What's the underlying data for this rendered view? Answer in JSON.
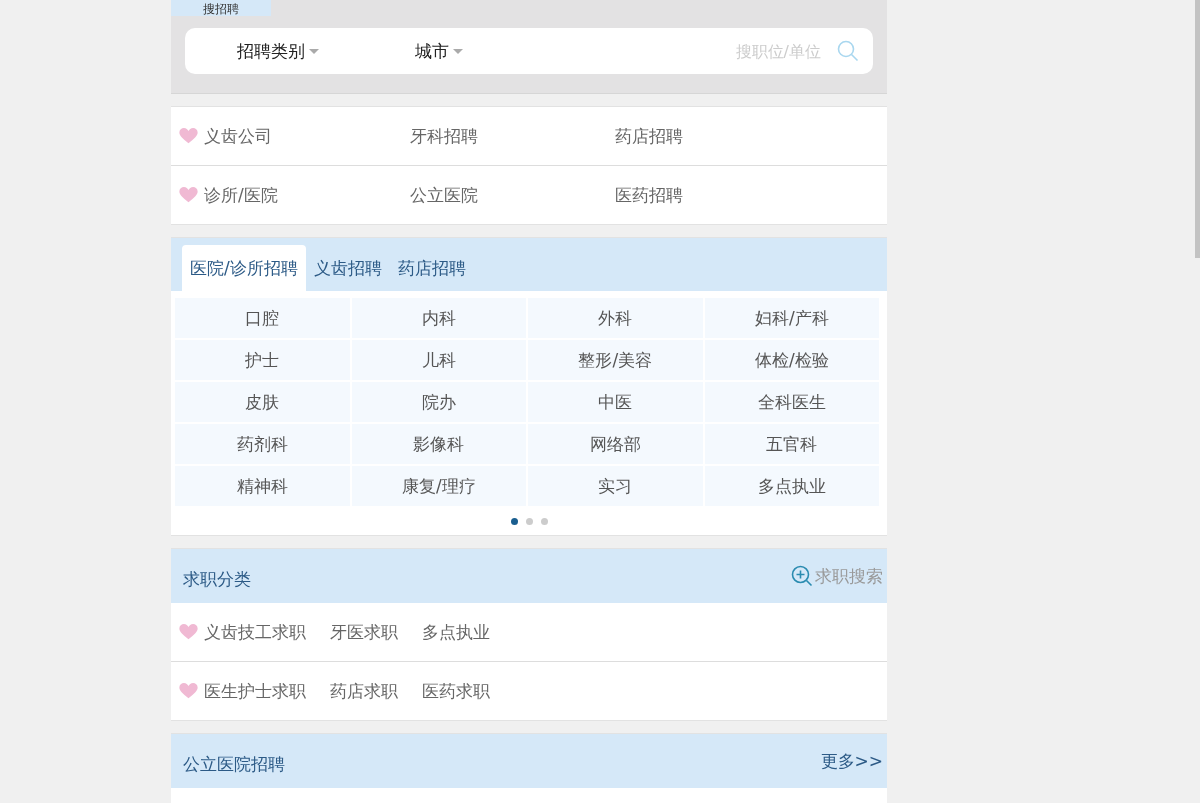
{
  "top_tab": {
    "label": "搜招聘"
  },
  "search": {
    "filters": [
      {
        "label": "招聘类别"
      },
      {
        "label": "城市"
      }
    ],
    "placeholder": "搜职位/单位"
  },
  "quick_links": [
    [
      "义齿公司",
      "牙科招聘",
      "药店招聘"
    ],
    [
      "诊所/医院",
      "公立医院",
      "医药招聘"
    ]
  ],
  "recruit_tabs": [
    {
      "label": "医院/诊所招聘",
      "selected": true
    },
    {
      "label": "义齿招聘",
      "selected": false
    },
    {
      "label": "药店招聘",
      "selected": false
    }
  ],
  "departments": [
    "口腔",
    "内科",
    "外科",
    "妇科/产科",
    "护士",
    "儿科",
    "整形/美容",
    "体检/检验",
    "皮肤",
    "院办",
    "中医",
    "全科医生",
    "药剂科",
    "影像科",
    "网络部",
    "五官科",
    "精神科",
    "康复/理疗",
    "实习",
    "多点执业"
  ],
  "pages": [
    {
      "selected": true
    },
    {
      "selected": false
    },
    {
      "selected": false
    }
  ],
  "job_seeking": {
    "title": "求职分类",
    "search_link": "求职搜索",
    "rows": [
      [
        "义齿技工求职",
        "牙医求职",
        "多点执业"
      ],
      [
        "医生护士求职",
        "药店求职",
        "医药求职"
      ]
    ]
  },
  "public_hospital": {
    "title": "公立医院招聘",
    "more": "更多>>"
  }
}
